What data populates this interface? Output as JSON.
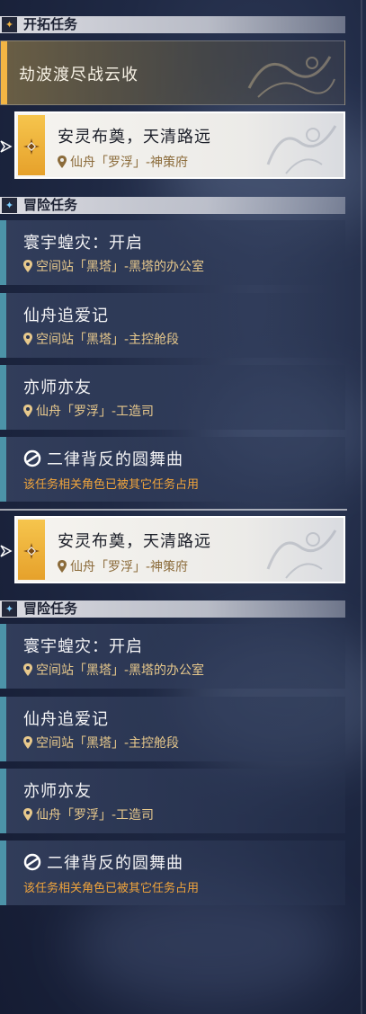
{
  "sections": {
    "trailblaze": {
      "title": "开拓任务"
    },
    "adventure": {
      "title": "冒险任务"
    }
  },
  "trailblaze_card": {
    "title": "劫波渡尽战云收"
  },
  "tracked_task": {
    "title": "安灵布奠，天清路远",
    "location": "仙舟「罗浮」-神策府"
  },
  "adventure_tasks": [
    {
      "title": "寰宇蝗灾：开启",
      "location": "空间站「黑塔」-黑塔的办公室"
    },
    {
      "title": "仙舟追爱记",
      "location": "空间站「黑塔」-主控舱段"
    },
    {
      "title": "亦师亦友",
      "location": "仙舟「罗浮」-工造司"
    },
    {
      "title": "二律背反的圆舞曲",
      "warning": "该任务相关角色已被其它任务占用"
    }
  ],
  "colors": {
    "accent_gold": "#f2b544",
    "accent_teal": "#4c93a8",
    "location_text": "#e8c98c",
    "warning_text": "#f0a43c"
  },
  "icons": {
    "section_trailblaze": "diamond-star-icon",
    "section_adventure": "four-point-star-icon",
    "location": "map-pin-icon",
    "occupied": "character-occupied-icon",
    "tracking": "tracking-arrow-icon"
  }
}
